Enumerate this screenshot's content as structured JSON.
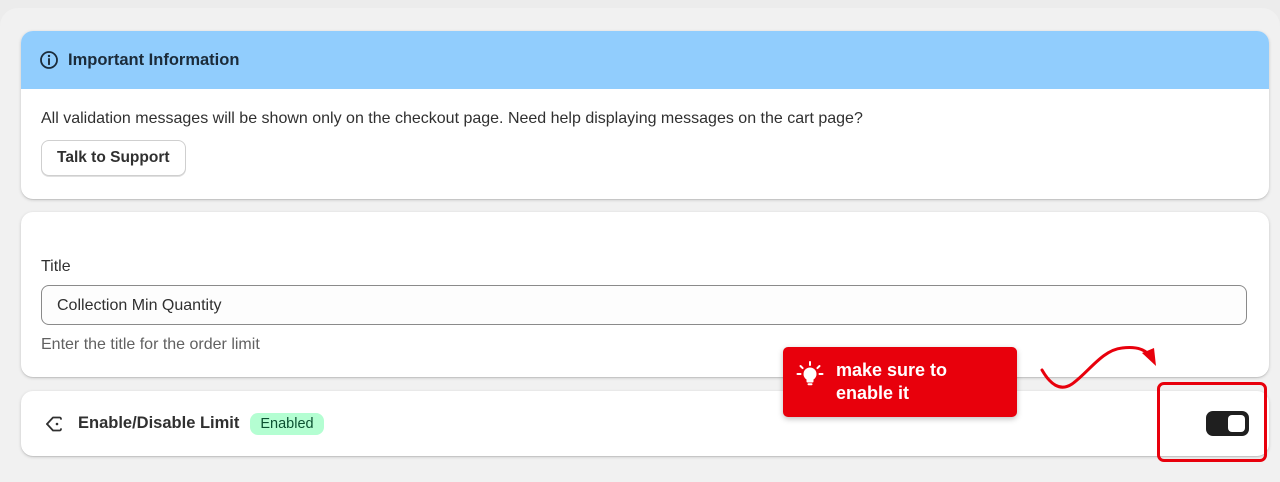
{
  "info_card": {
    "title": "Important Information",
    "message": "All validation messages will be shown only on the checkout page. Need help displaying messages on the cart page?",
    "support_button": "Talk to Support"
  },
  "title_card": {
    "label": "Title",
    "value": "Collection Min Quantity",
    "help_text": "Enter the title for the order limit"
  },
  "toggle_card": {
    "label": "Enable/Disable Limit",
    "status_badge": "Enabled",
    "enabled": true
  },
  "annotation": {
    "callout_text": "make sure to enable it"
  },
  "colors": {
    "banner": "#91cdfd",
    "badge_bg": "#b4fed2",
    "badge_text": "#0c5132",
    "annotation_red": "#e8000c",
    "toggle_on": "#1f1f1f"
  },
  "icons": {
    "info": "info-circle-icon",
    "limit": "tag-icon",
    "bulb": "lightbulb-icon"
  }
}
